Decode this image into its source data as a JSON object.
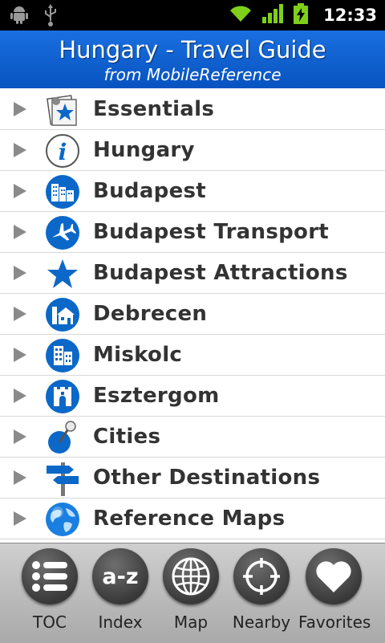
{
  "status_bar": {
    "time": "12:33",
    "icons": [
      "android-debug-icon",
      "usb-icon",
      "wifi-icon",
      "signal-icon",
      "battery-charging-icon"
    ]
  },
  "header": {
    "title": "Hungary - Travel Guide",
    "subtitle": "from MobileReference"
  },
  "menu": {
    "items": [
      {
        "label": "Essentials",
        "icon": "essentials-star-icon"
      },
      {
        "label": "Hungary",
        "icon": "info-icon"
      },
      {
        "label": "Budapest",
        "icon": "city-buildings-icon"
      },
      {
        "label": "Budapest Transport",
        "icon": "airplane-icon"
      },
      {
        "label": "Budapest Attractions",
        "icon": "star-icon"
      },
      {
        "label": "Debrecen",
        "icon": "house-icon"
      },
      {
        "label": "Miskolc",
        "icon": "building-icon"
      },
      {
        "label": "Esztergom",
        "icon": "castle-tower-icon"
      },
      {
        "label": "Cities",
        "icon": "pushpin-icon"
      },
      {
        "label": "Other Destinations",
        "icon": "signpost-icon"
      },
      {
        "label": "Reference Maps",
        "icon": "globe-icon"
      }
    ]
  },
  "toolbar": {
    "tabs": [
      {
        "label": "TOC",
        "icon": "list-icon"
      },
      {
        "label": "Index",
        "icon": "a-z-icon"
      },
      {
        "label": "Map",
        "icon": "globe-grid-icon"
      },
      {
        "label": "Nearby",
        "icon": "crosshair-icon"
      },
      {
        "label": "Favorites",
        "icon": "heart-icon"
      }
    ],
    "index_glyph": "a-z"
  },
  "colors": {
    "header_blue": "#0a5fd0",
    "icon_blue": "#0b68c8",
    "label_text": "#333333"
  }
}
